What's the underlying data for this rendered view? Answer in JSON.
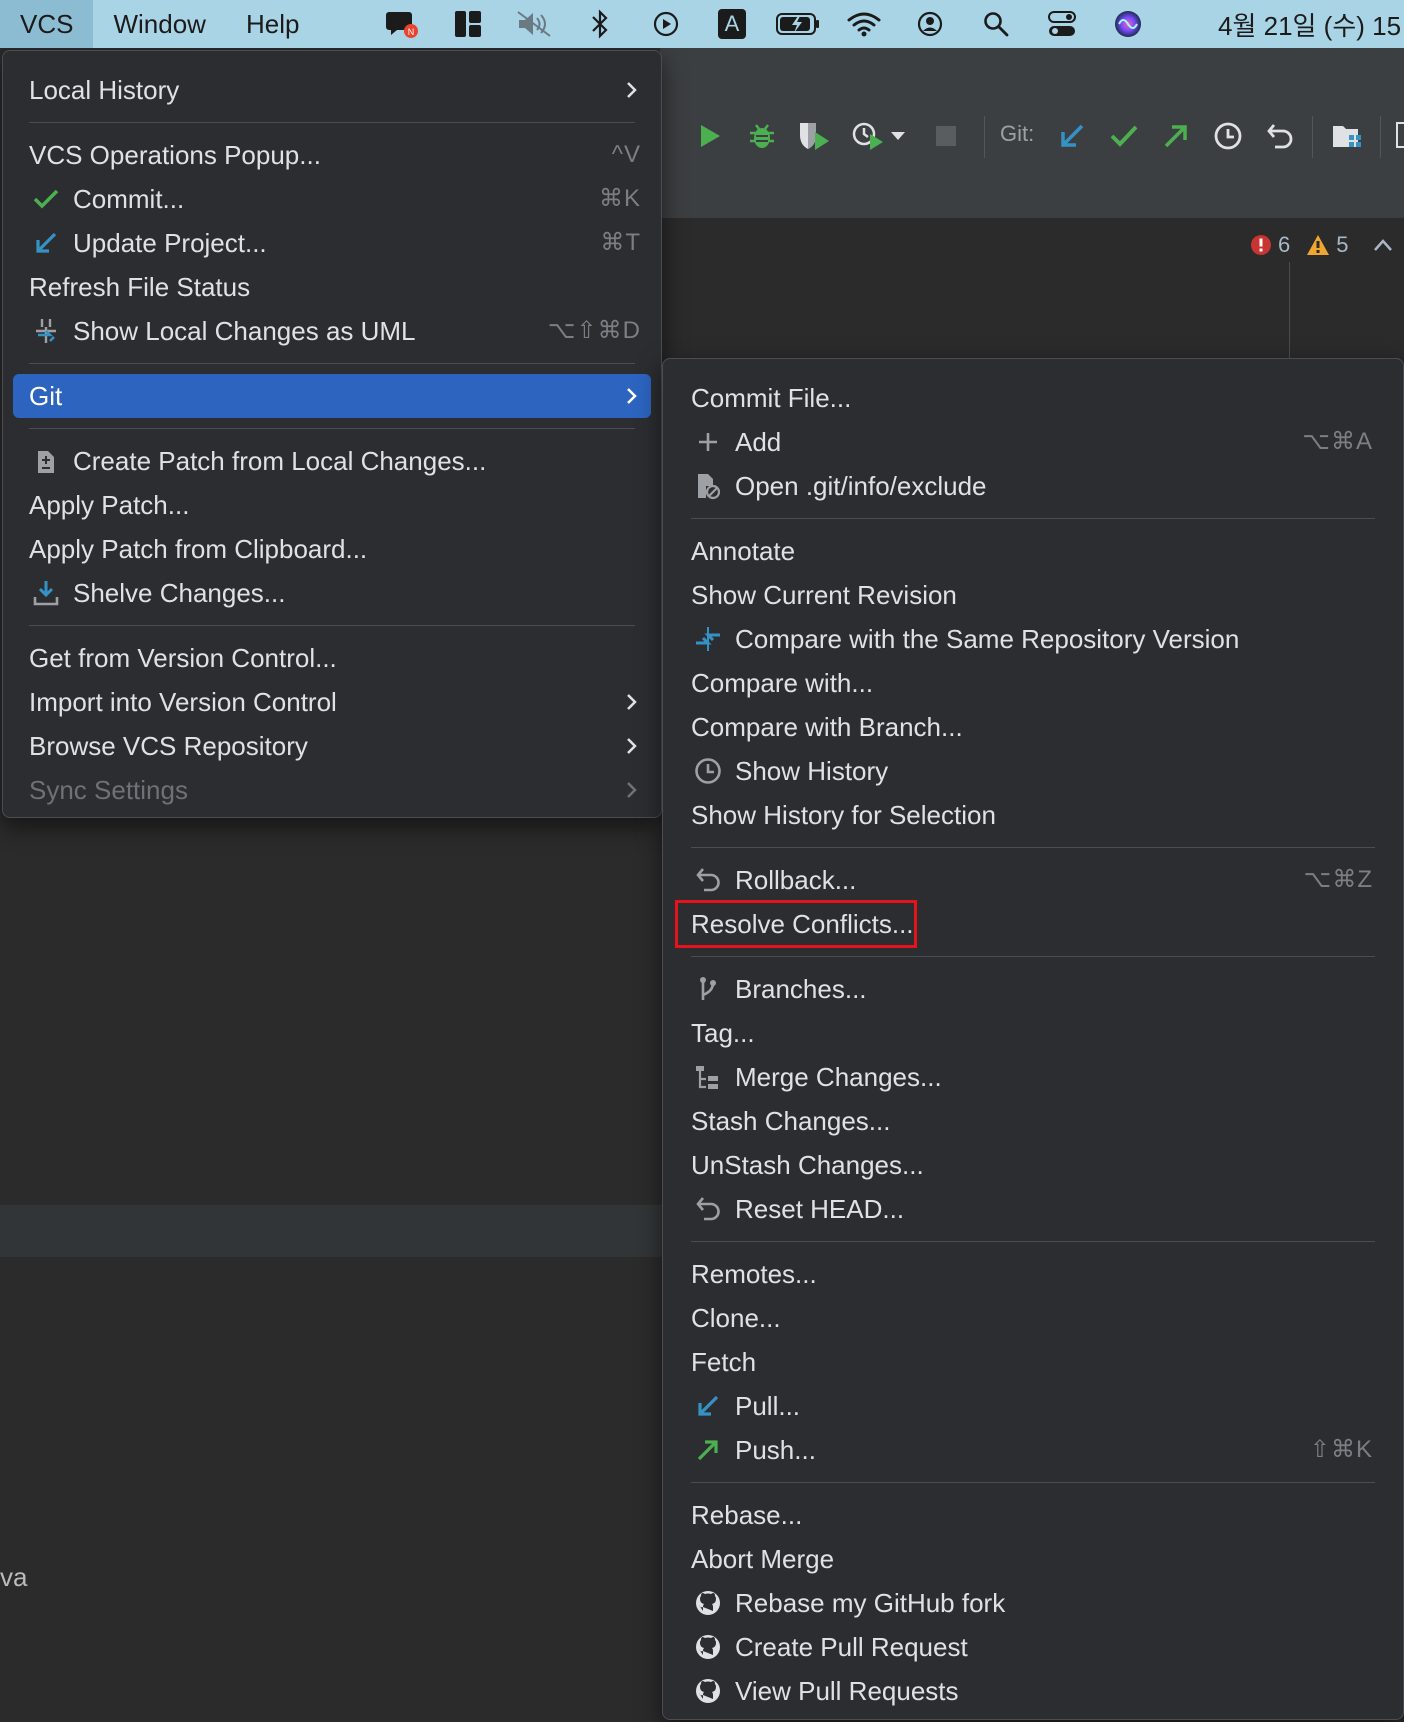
{
  "menubar": {
    "items": [
      "VCS",
      "Window",
      "Help"
    ],
    "active": "VCS",
    "status_icons": [
      "notification-icon",
      "layout-icon",
      "mute-icon",
      "bluetooth-icon",
      "play-icon",
      "input-source-icon",
      "battery-icon",
      "wifi-icon",
      "user-icon",
      "search-icon",
      "control-center-icon",
      "siri-icon"
    ],
    "input_source": "A",
    "notification_badge": "N",
    "clock": "4월 21일 (수) 15"
  },
  "toolbar": {
    "git_label": "Git:",
    "icons": [
      "run-icon",
      "debug-icon",
      "coverage-icon",
      "profile-icon",
      "stop-icon",
      "git-update-icon",
      "git-commit-icon",
      "git-push-icon",
      "history-icon",
      "rollback-icon",
      "project-structure-icon"
    ]
  },
  "inspections": {
    "errors": "6",
    "warnings": "5"
  },
  "side_text": "va",
  "colors": {
    "selection": "#2c64c0",
    "highlight": "#e5131c",
    "green": "#4caf50",
    "blue": "#3592c4"
  },
  "vcs_menu": {
    "items": [
      {
        "label": "Local History",
        "submenu": true
      },
      {
        "separator": true
      },
      {
        "label": "VCS Operations Popup...",
        "shortcut": "^V"
      },
      {
        "label": "Commit...",
        "shortcut": "⌘K",
        "icon": "check-icon"
      },
      {
        "label": "Update Project...",
        "shortcut": "⌘T",
        "icon": "update-arrow-icon"
      },
      {
        "label": "Refresh File Status"
      },
      {
        "label": "Show Local Changes as UML",
        "shortcut": "⌥⇧⌘D",
        "icon": "uml-icon"
      },
      {
        "separator": true
      },
      {
        "label": "Git",
        "submenu": true,
        "selected": true
      },
      {
        "separator": true
      },
      {
        "label": "Create Patch from Local Changes...",
        "icon": "patch-icon"
      },
      {
        "label": "Apply Patch..."
      },
      {
        "label": "Apply Patch from Clipboard..."
      },
      {
        "label": "Shelve Changes...",
        "icon": "shelve-icon"
      },
      {
        "separator": true
      },
      {
        "label": "Get from Version Control..."
      },
      {
        "label": "Import into Version Control",
        "submenu": true
      },
      {
        "label": "Browse VCS Repository",
        "submenu": true
      },
      {
        "label": "Sync Settings",
        "submenu": true,
        "disabled": true
      }
    ]
  },
  "git_menu": {
    "items": [
      {
        "label": "Commit File..."
      },
      {
        "label": "Add",
        "shortcut": "⌥⌘A",
        "icon": "plus-icon"
      },
      {
        "label": "Open .git/info/exclude",
        "icon": "ignore-file-icon"
      },
      {
        "separator": true
      },
      {
        "label": "Annotate"
      },
      {
        "label": "Show Current Revision"
      },
      {
        "label": "Compare with the Same Repository Version",
        "icon": "compare-icon"
      },
      {
        "label": "Compare with..."
      },
      {
        "label": "Compare with Branch..."
      },
      {
        "label": "Show History",
        "icon": "clock-icon"
      },
      {
        "label": "Show History for Selection"
      },
      {
        "separator": true
      },
      {
        "label": "Rollback...",
        "shortcut": "⌥⌘Z",
        "icon": "rollback-icon"
      },
      {
        "label": "Resolve Conflicts...",
        "highlighted": true
      },
      {
        "separator": true
      },
      {
        "label": "Branches...",
        "icon": "branch-icon"
      },
      {
        "label": "Tag..."
      },
      {
        "label": "Merge Changes...",
        "icon": "merge-icon"
      },
      {
        "label": "Stash Changes..."
      },
      {
        "label": "UnStash Changes..."
      },
      {
        "label": "Reset HEAD...",
        "icon": "reset-icon"
      },
      {
        "separator": true
      },
      {
        "label": "Remotes..."
      },
      {
        "label": "Clone..."
      },
      {
        "label": "Fetch"
      },
      {
        "label": "Pull...",
        "icon": "pull-arrow-icon"
      },
      {
        "label": "Push...",
        "shortcut": "⇧⌘K",
        "icon": "push-arrow-icon"
      },
      {
        "separator": true
      },
      {
        "label": "Rebase..."
      },
      {
        "label": "Abort Merge"
      },
      {
        "label": "Rebase my GitHub fork",
        "icon": "github-icon"
      },
      {
        "label": "Create Pull Request",
        "icon": "github-icon"
      },
      {
        "label": "View Pull Requests",
        "icon": "github-icon"
      }
    ]
  }
}
